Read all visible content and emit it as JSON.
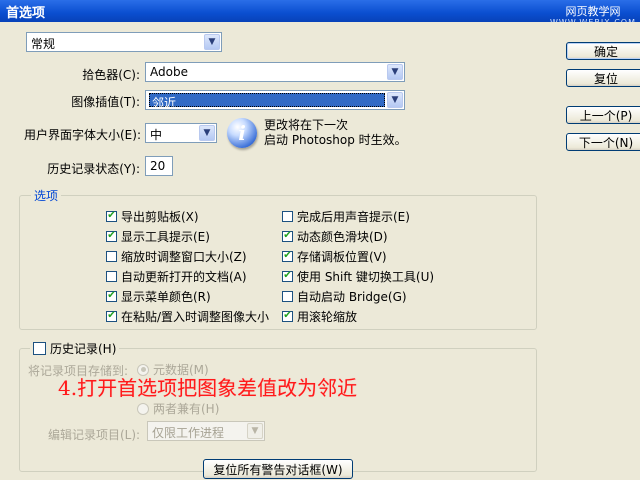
{
  "window": {
    "title": "首选项"
  },
  "watermark": {
    "line1": "网页教学网",
    "line2": "WWW.WEBJX.COM"
  },
  "category": {
    "selected": "常规"
  },
  "fields": {
    "color_picker": {
      "label": "拾色器(C):",
      "value": "Adobe"
    },
    "interpolation": {
      "label": "图像插值(T):",
      "value": "邻近"
    },
    "ui_font_size": {
      "label": "用户界面字体大小(E):",
      "value": "中"
    },
    "info_line1": "更改将在下一次",
    "info_line2": "启动 Photoshop 时生效。",
    "history_states": {
      "label": "历史记录状态(Y):",
      "value": "20"
    }
  },
  "buttons": {
    "ok": "确定",
    "reset": "复位",
    "prev": "上一个(P)",
    "next": "下一个(N)",
    "reset_warnings": "复位所有警告对话框(W)"
  },
  "options": {
    "legend": "选项",
    "left": [
      {
        "label": "导出剪贴板(X)",
        "checked": true
      },
      {
        "label": "显示工具提示(E)",
        "checked": true
      },
      {
        "label": "缩放时调整窗口大小(Z)",
        "checked": false
      },
      {
        "label": "自动更新打开的文档(A)",
        "checked": false
      },
      {
        "label": "显示菜单颜色(R)",
        "checked": true
      },
      {
        "label": "在粘贴/置入时调整图像大小",
        "checked": true
      }
    ],
    "right": [
      {
        "label": "完成后用声音提示(E)",
        "checked": false
      },
      {
        "label": "动态颜色滑块(D)",
        "checked": true
      },
      {
        "label": "存储调板位置(V)",
        "checked": true
      },
      {
        "label": "使用 Shift 键切换工具(U)",
        "checked": true
      },
      {
        "label": "自动启动 Bridge(G)",
        "checked": false
      },
      {
        "label": "用滚轮缩放",
        "checked": true
      }
    ]
  },
  "history": {
    "legend": "历史记录(H)",
    "save_to_label": "将记录项目存储到:",
    "radio_metadata": "元数据(M)",
    "radio_both": "两者兼有(H)",
    "edit_log_label": "编辑记录项目(L):",
    "edit_log_value": "仅限工作进程"
  },
  "annotation": "4.打开首选项把图象差值改为邻近",
  "check_glyph": "✔"
}
